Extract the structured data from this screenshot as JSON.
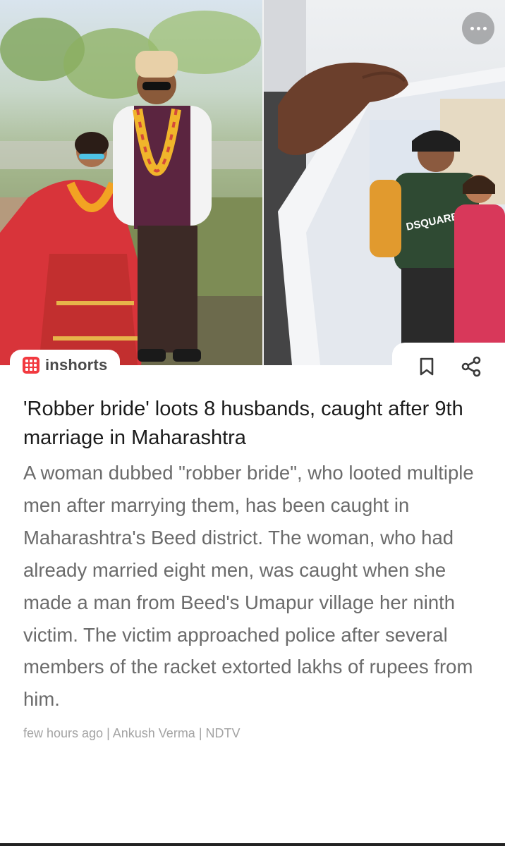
{
  "app": {
    "brand_name": "inshorts",
    "brand_color": "#f23a40"
  },
  "hero": {
    "left_photo": "wedding-couple-photo",
    "right_photo": "printed-photo-held-in-hand",
    "printed_shirt_text": "DSQUARED"
  },
  "toolbar": {
    "more_icon": "more-horizontal-icon",
    "bookmark_icon": "bookmark-icon",
    "share_icon": "share-icon"
  },
  "article": {
    "headline": "'Robber bride' loots 8 husbands, caught after 9th marriage in Maharashtra",
    "body": "A woman dubbed \"robber bride\", who looted multiple men after marrying them, has been caught in Maharashtra's Beed district. The woman, who had already married eight men, was caught when she made a man from Beed's Umapur village her ninth victim. The victim approached police after several members of the racket extorted lakhs of rupees from him.",
    "meta": "few hours ago | Ankush Verma | NDTV"
  }
}
